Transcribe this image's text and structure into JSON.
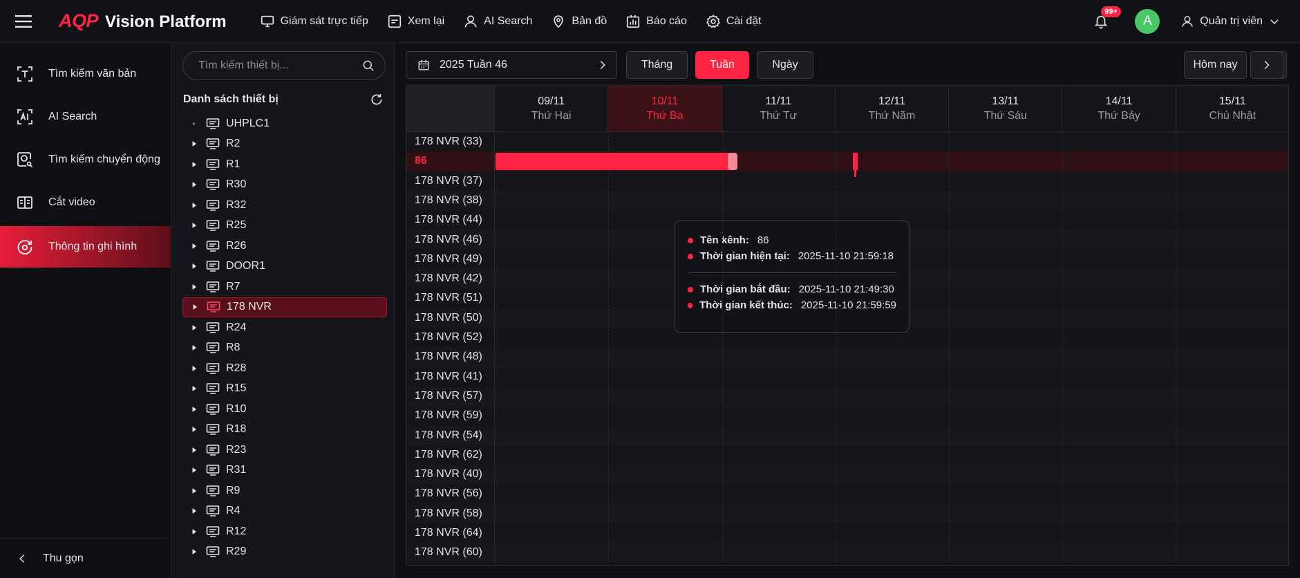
{
  "app": {
    "brand_a": "AQP",
    "brand_b": "Vision Platform"
  },
  "nav": [
    {
      "label": "Giám sát trực tiếp",
      "icon": "monitor-icon"
    },
    {
      "label": "Xem lại",
      "icon": "playback-icon"
    },
    {
      "label": "AI Search",
      "icon": "person-search-icon"
    },
    {
      "label": "Bản đồ",
      "icon": "map-pin-icon"
    },
    {
      "label": "Báo cáo",
      "icon": "report-icon"
    },
    {
      "label": "Cài đặt",
      "icon": "gear-icon"
    }
  ],
  "header": {
    "notifications": "99+",
    "avatar_letter": "A",
    "user_name": "Quản trị viên"
  },
  "sidebar": {
    "items": [
      {
        "label": "Tìm kiếm văn bản",
        "icon": "text-search-icon"
      },
      {
        "label": "AI Search",
        "icon": "ai-icon"
      },
      {
        "label": "Tìm kiếm chuyển động",
        "icon": "motion-search-icon"
      },
      {
        "label": "Cắt video",
        "icon": "video-cut-icon"
      },
      {
        "label": "Thông tin ghi hình",
        "icon": "recording-info-icon",
        "active": true
      }
    ],
    "collapse_label": "Thu gọn"
  },
  "device_tree": {
    "search_placeholder": "Tìm kiếm thiết bị...",
    "title": "Danh sách thiết bị",
    "devices": [
      "UHPLC1",
      "R2",
      "R1",
      "R30",
      "R32",
      "R25",
      "R26",
      "DOOR1",
      "R7",
      "178 NVR",
      "R24",
      "R8",
      "R28",
      "R15",
      "R10",
      "R18",
      "R23",
      "R31",
      "R9",
      "R4",
      "R12",
      "R29"
    ],
    "selected": "178 NVR"
  },
  "toolbar": {
    "week_label": "2025 Tuần 46",
    "month": "Tháng",
    "week": "Tuần",
    "day": "Ngày",
    "today": "Hôm nay",
    "active_view": "Tuần"
  },
  "calendar": {
    "days": [
      {
        "date": "09/11",
        "weekday": "Thứ Hai"
      },
      {
        "date": "10/11",
        "weekday": "Thứ Ba",
        "today": true
      },
      {
        "date": "11/11",
        "weekday": "Thứ Tư"
      },
      {
        "date": "12/11",
        "weekday": "Thứ Năm"
      },
      {
        "date": "13/11",
        "weekday": "Thứ Sáu"
      },
      {
        "date": "14/11",
        "weekday": "Thứ Bảy"
      },
      {
        "date": "15/11",
        "weekday": "Chủ Nhật"
      }
    ],
    "channels": [
      "178 NVR (33)",
      "86",
      "178 NVR (37)",
      "178 NVR (38)",
      "178 NVR (44)",
      "178 NVR (46)",
      "178 NVR (49)",
      "178 NVR (42)",
      "178 NVR (51)",
      "178 NVR (50)",
      "178 NVR (52)",
      "178 NVR (48)",
      "178 NVR (41)",
      "178 NVR (57)",
      "178 NVR (59)",
      "178 NVR (54)",
      "178 NVR (62)",
      "178 NVR (40)",
      "178 NVR (56)",
      "178 NVR (58)",
      "178 NVR (64)",
      "178 NVR (60)"
    ],
    "highlighted_channel": "86",
    "colors": {
      "accent": "#ff2442",
      "segment_end": "#f08a94"
    }
  },
  "tooltip": {
    "channel_label": "Tên kênh:",
    "channel_value": "86",
    "current_label": "Thời gian hiện tại:",
    "current_value": "2025-11-10 21:59:18",
    "start_label": "Thời gian bắt đầu:",
    "start_value": "2025-11-10 21:49:30",
    "end_label": "Thời gian kết thúc:",
    "end_value": "2025-11-10 21:59:59"
  }
}
